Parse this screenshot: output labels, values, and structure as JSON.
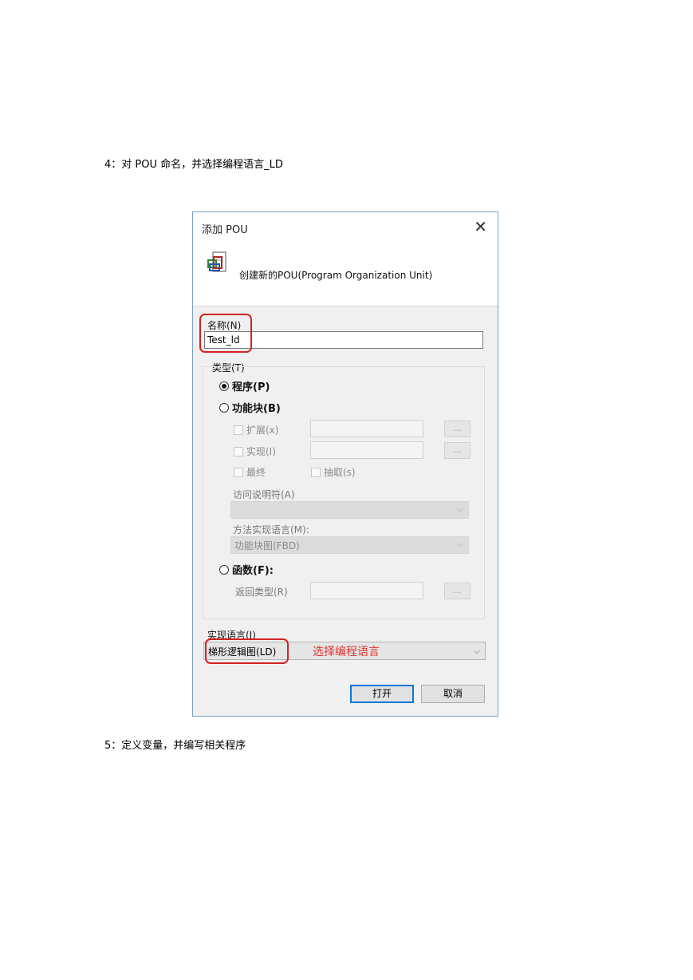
{
  "doc": {
    "step4": "4：对 POU 命名，并选择编程语言_LD",
    "step5": "5：定义变量，并编写相关程序"
  },
  "dialog": {
    "title": "添加 POU",
    "close": "✕",
    "subtitle": "创建新的POU(Program Organization Unit)",
    "name_label": "名称(N)",
    "name_value": "Test_ld",
    "type_label": "类型(T)",
    "radio_program": "程序(P)",
    "radio_function_block": "功能块(B)",
    "extends_label": "扩展(x)",
    "implements_label": "实现(I)",
    "final_label": "最终",
    "abstract_label": "抽取(s)",
    "browse": "...",
    "access_label": "访问说明符(A)",
    "access_value": "",
    "method_lang_label": "方法实现语言(M):",
    "method_lang_value": "功能块图(FBD)",
    "radio_function": "函数(F):",
    "return_type_label": "返回类型(R)",
    "impl_lang_label": "实现语言(I)",
    "impl_lang_value": "梯形逻辑图(LD)",
    "annotation": "选择编程语言",
    "open_button": "打开",
    "cancel_button": "取消"
  },
  "colors": {
    "annotation_red": "#d42222",
    "focus_blue": "#0078d7"
  }
}
